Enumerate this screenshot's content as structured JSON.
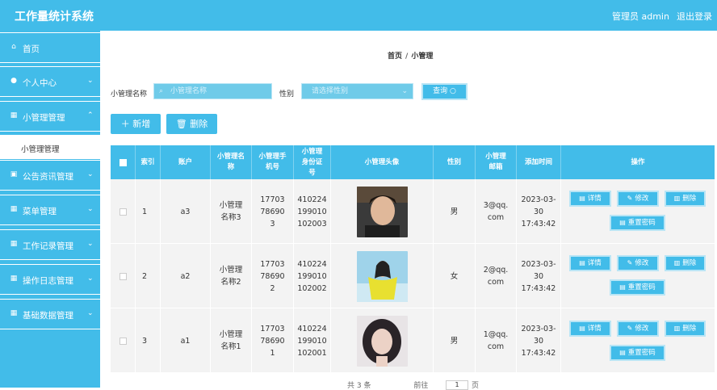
{
  "header": {
    "title": "工作量统计系统",
    "user": "管理员 admin",
    "logout": "退出登录"
  },
  "sidebar": {
    "items": [
      {
        "label": "首页",
        "icon": "home-icon"
      },
      {
        "label": "个人中心",
        "icon": "user-icon"
      },
      {
        "label": "小管理管理",
        "icon": "grid-icon"
      },
      {
        "label": "公告资讯管理",
        "icon": "briefcase-icon"
      },
      {
        "label": "菜单管理",
        "icon": "grid-icon"
      },
      {
        "label": "工作记录管理",
        "icon": "grid-icon"
      },
      {
        "label": "操作日志管理",
        "icon": "grid-icon"
      },
      {
        "label": "基础数据管理",
        "icon": "grid-icon"
      }
    ],
    "submenu_label": "小管理管理"
  },
  "breadcrumb": {
    "home": "首页",
    "sep": "/",
    "current": "小管理"
  },
  "search": {
    "name_label": "小管理名称",
    "name_placeholder": "小管理名称",
    "gender_label": "性别",
    "gender_placeholder": "请选择性别",
    "query_label": "查询"
  },
  "actions": {
    "add_label": "新增",
    "delete_label": "删除"
  },
  "table": {
    "headers": [
      "索引",
      "账户",
      "小管理名称",
      "小管理手机号",
      "小管理身份证号",
      "小管理头像",
      "性别",
      "小管理邮箱",
      "添加时间",
      "操作"
    ],
    "rows": [
      {
        "index": "1",
        "account": "a3",
        "name": "小管理名称3",
        "phone": "17703786903",
        "idcard": "410224199010102003",
        "gender": "男",
        "email": "3@qq.com",
        "time": "2023-03-30 17:43:42"
      },
      {
        "index": "2",
        "account": "a2",
        "name": "小管理名称2",
        "phone": "17703786902",
        "idcard": "410224199010102002",
        "gender": "女",
        "email": "2@qq.com",
        "time": "2023-03-30 17:43:42"
      },
      {
        "index": "3",
        "account": "a1",
        "name": "小管理名称1",
        "phone": "17703786901",
        "idcard": "410224199010102001",
        "gender": "男",
        "email": "1@qq.com",
        "time": "2023-03-30 17:43:42"
      }
    ],
    "op_labels": {
      "detail": "详情",
      "edit": "修改",
      "delete": "删除",
      "reset": "重置密码"
    }
  },
  "pager": {
    "total": "共 3 条",
    "goto": "前往",
    "page": "1",
    "unit": "页"
  },
  "colors": {
    "accent": "#42bce9",
    "row_bg": "#f3f3f3"
  }
}
